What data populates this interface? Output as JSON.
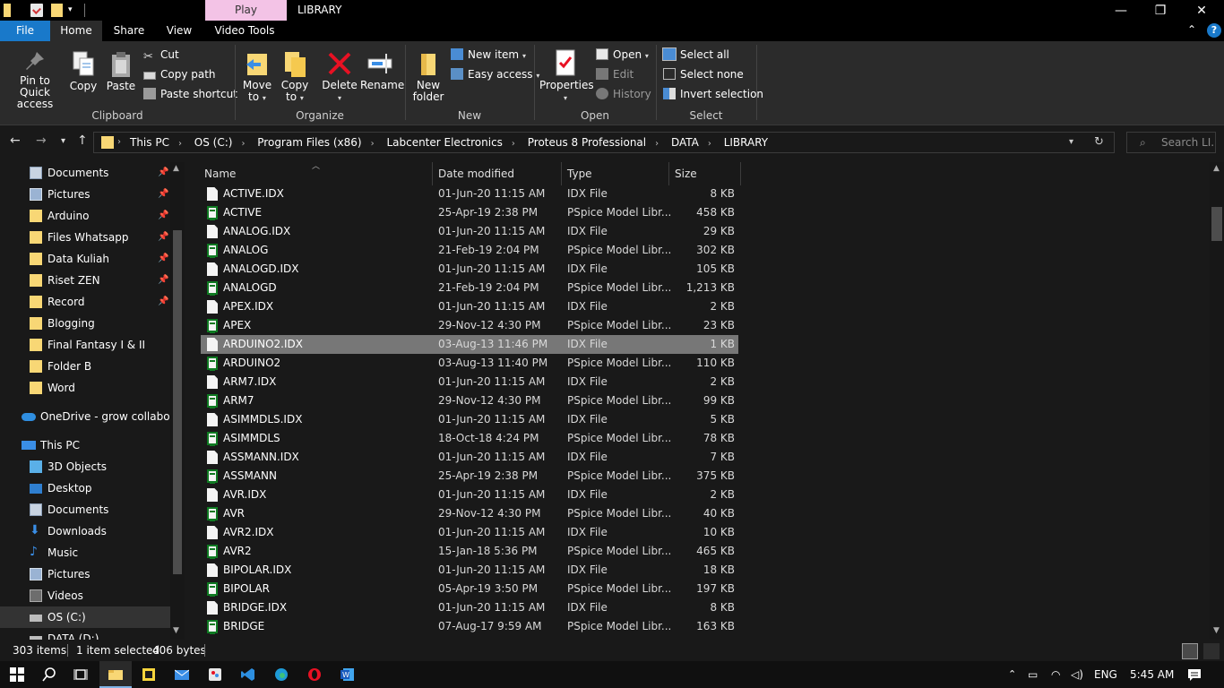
{
  "window": {
    "title": "LIBRARY",
    "contextual_tab": "Play",
    "controls": {
      "minimize": "—",
      "restore": "❐",
      "close": "✕"
    }
  },
  "ribbon_tabs": [
    "File",
    "Home",
    "Share",
    "View",
    "Video Tools"
  ],
  "ribbon": {
    "clipboard": {
      "label": "Clipboard",
      "pin": "Pin to Quick access",
      "copy": "Copy",
      "paste": "Paste",
      "cut": "Cut",
      "copy_path": "Copy path",
      "paste_shortcut": "Paste shortcut"
    },
    "organize": {
      "label": "Organize",
      "move_to": "Move to",
      "copy_to": "Copy to",
      "delete": "Delete",
      "rename": "Rename"
    },
    "new": {
      "label": "New",
      "new_folder": "New folder",
      "new_item": "New item",
      "easy_access": "Easy access"
    },
    "open": {
      "label": "Open",
      "properties": "Properties",
      "open": "Open",
      "edit": "Edit",
      "history": "History"
    },
    "select": {
      "label": "Select",
      "select_all": "Select all",
      "select_none": "Select none",
      "invert_selection": "Invert selection"
    }
  },
  "address": {
    "breadcrumbs": [
      "This PC",
      "OS (C:)",
      "Program Files (x86)",
      "Labcenter Electronics",
      "Proteus 8 Professional",
      "DATA",
      "LIBRARY"
    ],
    "search_placeholder": "Search LI..."
  },
  "nav_pane": {
    "quick_access": [
      {
        "label": "Documents",
        "pinned": true
      },
      {
        "label": "Pictures",
        "pinned": true
      },
      {
        "label": "Arduino",
        "pinned": true
      },
      {
        "label": "Files Whatsapp",
        "pinned": true
      },
      {
        "label": "Data Kuliah",
        "pinned": true
      },
      {
        "label": "Riset ZEN",
        "pinned": true
      },
      {
        "label": "Record",
        "pinned": true
      },
      {
        "label": "Blogging",
        "pinned": false
      },
      {
        "label": "Final Fantasy I & II",
        "pinned": false
      },
      {
        "label": "Folder B",
        "pinned": false
      },
      {
        "label": "Word",
        "pinned": false
      }
    ],
    "onedrive": "OneDrive - grow collaborati",
    "this_pc": "This PC",
    "this_pc_items": [
      "3D Objects",
      "Desktop",
      "Documents",
      "Downloads",
      "Music",
      "Pictures",
      "Videos",
      "OS (C:)",
      "DATA (D:)"
    ]
  },
  "columns": {
    "name": "Name",
    "date": "Date modified",
    "type": "Type",
    "size": "Size"
  },
  "files": [
    {
      "name": "ACTIVE.IDX",
      "date": "01-Jun-20 11:15 AM",
      "type": "IDX File",
      "size": "8 KB",
      "icon": "doc"
    },
    {
      "name": "ACTIVE",
      "date": "25-Apr-19 2:38 PM",
      "type": "PSpice Model Libr...",
      "size": "458 KB",
      "icon": "lib"
    },
    {
      "name": "ANALOG.IDX",
      "date": "01-Jun-20 11:15 AM",
      "type": "IDX File",
      "size": "29 KB",
      "icon": "doc"
    },
    {
      "name": "ANALOG",
      "date": "21-Feb-19 2:04 PM",
      "type": "PSpice Model Libr...",
      "size": "302 KB",
      "icon": "lib"
    },
    {
      "name": "ANALOGD.IDX",
      "date": "01-Jun-20 11:15 AM",
      "type": "IDX File",
      "size": "105 KB",
      "icon": "doc"
    },
    {
      "name": "ANALOGD",
      "date": "21-Feb-19 2:04 PM",
      "type": "PSpice Model Libr...",
      "size": "1,213 KB",
      "icon": "lib"
    },
    {
      "name": "APEX.IDX",
      "date": "01-Jun-20 11:15 AM",
      "type": "IDX File",
      "size": "2 KB",
      "icon": "doc"
    },
    {
      "name": "APEX",
      "date": "29-Nov-12 4:30 PM",
      "type": "PSpice Model Libr...",
      "size": "23 KB",
      "icon": "lib"
    },
    {
      "name": "ARDUINO2.IDX",
      "date": "03-Aug-13 11:46 PM",
      "type": "IDX File",
      "size": "1 KB",
      "icon": "doc",
      "selected": true
    },
    {
      "name": "ARDUINO2",
      "date": "03-Aug-13 11:40 PM",
      "type": "PSpice Model Libr...",
      "size": "110 KB",
      "icon": "lib"
    },
    {
      "name": "ARM7.IDX",
      "date": "01-Jun-20 11:15 AM",
      "type": "IDX File",
      "size": "2 KB",
      "icon": "doc"
    },
    {
      "name": "ARM7",
      "date": "29-Nov-12 4:30 PM",
      "type": "PSpice Model Libr...",
      "size": "99 KB",
      "icon": "lib"
    },
    {
      "name": "ASIMMDLS.IDX",
      "date": "01-Jun-20 11:15 AM",
      "type": "IDX File",
      "size": "5 KB",
      "icon": "doc"
    },
    {
      "name": "ASIMMDLS",
      "date": "18-Oct-18 4:24 PM",
      "type": "PSpice Model Libr...",
      "size": "78 KB",
      "icon": "lib"
    },
    {
      "name": "ASSMANN.IDX",
      "date": "01-Jun-20 11:15 AM",
      "type": "IDX File",
      "size": "7 KB",
      "icon": "doc"
    },
    {
      "name": "ASSMANN",
      "date": "25-Apr-19 2:38 PM",
      "type": "PSpice Model Libr...",
      "size": "375 KB",
      "icon": "lib"
    },
    {
      "name": "AVR.IDX",
      "date": "01-Jun-20 11:15 AM",
      "type": "IDX File",
      "size": "2 KB",
      "icon": "doc"
    },
    {
      "name": "AVR",
      "date": "29-Nov-12 4:30 PM",
      "type": "PSpice Model Libr...",
      "size": "40 KB",
      "icon": "lib"
    },
    {
      "name": "AVR2.IDX",
      "date": "01-Jun-20 11:15 AM",
      "type": "IDX File",
      "size": "10 KB",
      "icon": "doc"
    },
    {
      "name": "AVR2",
      "date": "15-Jan-18 5:36 PM",
      "type": "PSpice Model Libr...",
      "size": "465 KB",
      "icon": "lib"
    },
    {
      "name": "BIPOLAR.IDX",
      "date": "01-Jun-20 11:15 AM",
      "type": "IDX File",
      "size": "18 KB",
      "icon": "doc"
    },
    {
      "name": "BIPOLAR",
      "date": "05-Apr-19 3:50 PM",
      "type": "PSpice Model Libr...",
      "size": "197 KB",
      "icon": "lib"
    },
    {
      "name": "BRIDGE.IDX",
      "date": "01-Jun-20 11:15 AM",
      "type": "IDX File",
      "size": "8 KB",
      "icon": "doc"
    },
    {
      "name": "BRIDGE",
      "date": "07-Aug-17 9:59 AM",
      "type": "PSpice Model Libr...",
      "size": "163 KB",
      "icon": "lib"
    }
  ],
  "status": {
    "item_count": "303 items",
    "selection": "1 item selected",
    "selection_size": "406 bytes"
  },
  "taskbar": {
    "language": "ENG",
    "time": "5:45 AM"
  },
  "colors": {
    "accent": "#1979ca",
    "contextual": "#f3c3e6",
    "folder": "#f8d775",
    "selection": "#777777"
  }
}
